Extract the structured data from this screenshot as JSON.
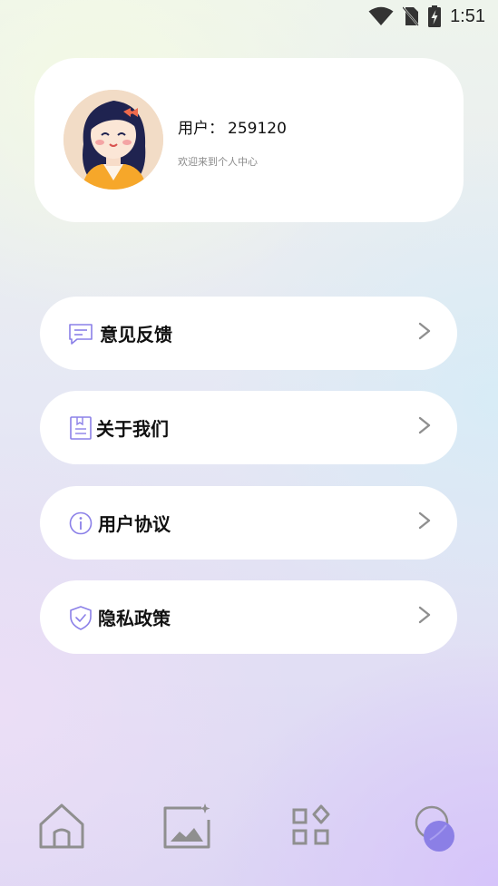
{
  "status_bar": {
    "time": "1:51",
    "icons": [
      "wifi-icon",
      "no-sim-icon",
      "battery-charging-icon"
    ]
  },
  "profile": {
    "avatar": "avatar-girl",
    "user_label": "用户：",
    "user_id": "259120",
    "welcome": "欢迎来到个人中心"
  },
  "menu": [
    {
      "label": "意见反馈",
      "icon": "feedback-icon"
    },
    {
      "label": "关于我们",
      "icon": "about-icon"
    },
    {
      "label": "用户协议",
      "icon": "info-icon"
    },
    {
      "label": "隐私政策",
      "icon": "shield-icon"
    }
  ],
  "bottom_nav": [
    {
      "name": "home",
      "icon": "home-icon"
    },
    {
      "name": "gallery",
      "icon": "image-icon"
    },
    {
      "name": "apps",
      "icon": "apps-icon"
    },
    {
      "name": "profile",
      "icon": "profile-planet-icon",
      "active": true
    }
  ],
  "colors": {
    "accent": "#8b80e8",
    "icon_gray": "#8f8f8f",
    "card_bg": "#ffffff"
  }
}
